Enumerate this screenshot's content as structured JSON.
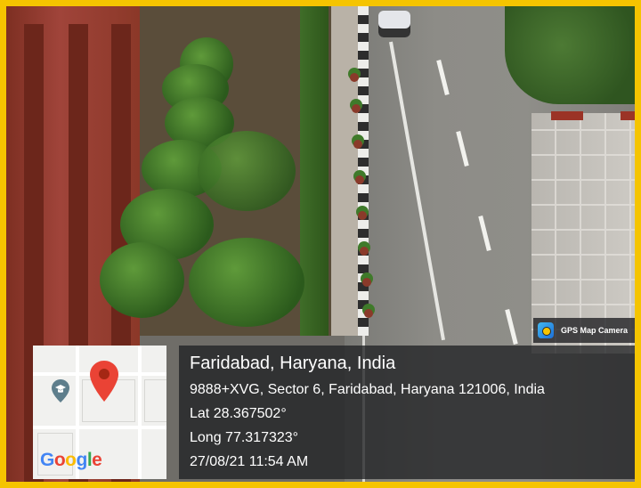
{
  "overlay": {
    "location_title": "Faridabad, Haryana, India",
    "address": "9888+XVG, Sector 6, Faridabad, Haryana 121006, India",
    "lat": "Lat 28.367502°",
    "long": "Long 77.317323°",
    "datetime": "27/08/21 11:54 AM"
  },
  "badge": {
    "app_name": "GPS Map Camera",
    "icon": "camera-icon"
  },
  "map": {
    "logo_letters": [
      "G",
      "o",
      "o",
      "g",
      "l",
      "e"
    ],
    "logo_colors": [
      "#4285F4",
      "#EA4335",
      "#FBBC05",
      "#4285F4",
      "#34A853",
      "#EA4335"
    ],
    "pin_icon": "map-pin-icon",
    "poi_icon": "school-icon",
    "pin_color": "#EA4335",
    "poi_color": "#5E7E8C"
  },
  "frame": {
    "border_color": "#F5C400"
  }
}
